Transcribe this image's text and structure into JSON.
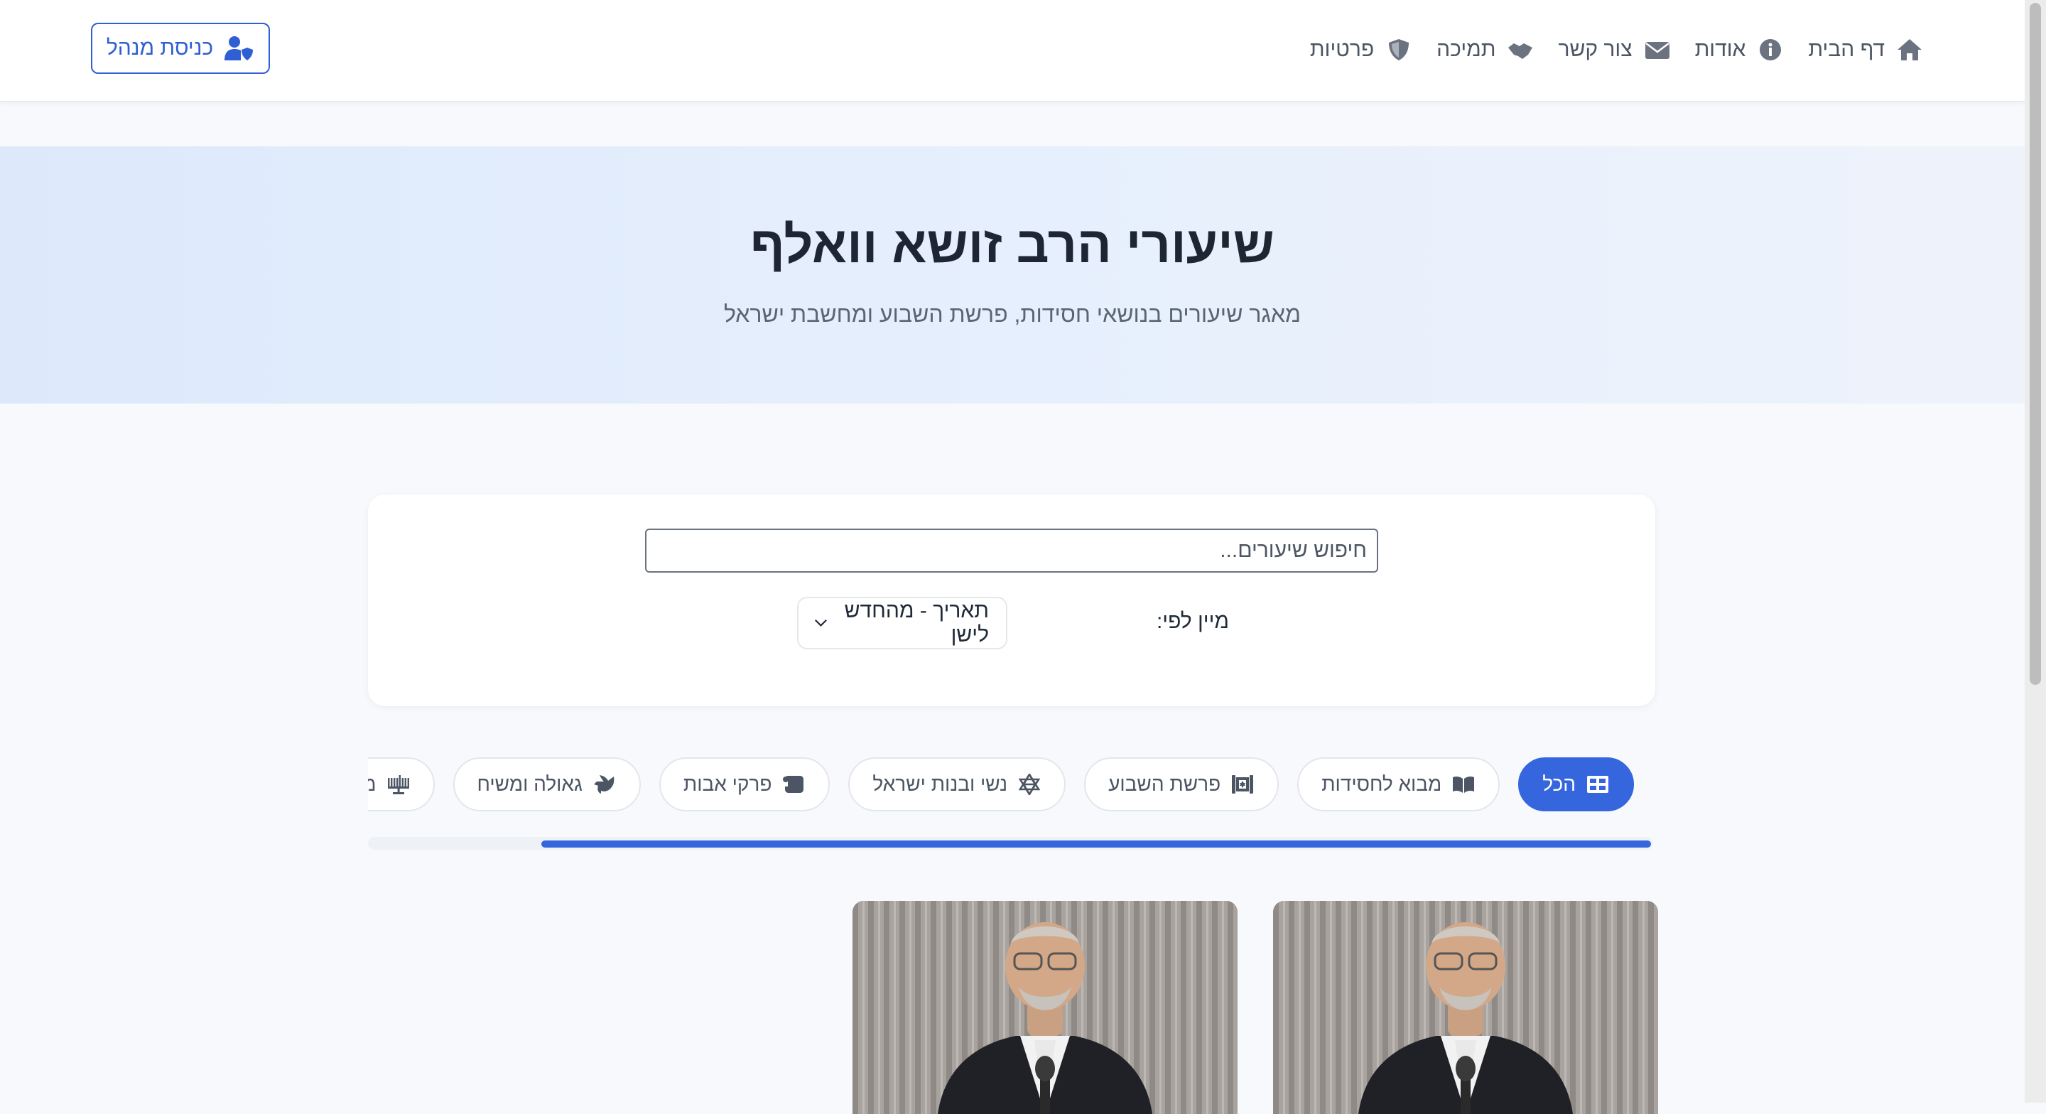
{
  "nav": {
    "links": [
      {
        "label": "דף הבית",
        "icon": "home-icon"
      },
      {
        "label": "אודות",
        "icon": "info-icon"
      },
      {
        "label": "צור קשר",
        "icon": "envelope-icon"
      },
      {
        "label": "תמיכה",
        "icon": "handshake-icon"
      },
      {
        "label": "פרטיות",
        "icon": "shield-icon"
      }
    ],
    "admin_button": "כניסת מנהל",
    "admin_icon": "user-shield-icon"
  },
  "hero": {
    "title": "שיעורי הרב זושא וואלף",
    "subtitle": "מאגר שיעורים בנושאי חסידות, פרשת השבוע ומחשבת ישראל"
  },
  "search": {
    "placeholder": "חיפוש שיעורים...",
    "value": "",
    "sort_label": "מיין לפי:",
    "sort_selected": "תאריך - מהחדש לישן"
  },
  "categories": [
    {
      "label": "הכל",
      "icon": "grid-icon",
      "active": true
    },
    {
      "label": "מבוא לחסידות",
      "icon": "book-open-icon",
      "active": false
    },
    {
      "label": "פרשת השבוע",
      "icon": "torah-icon",
      "active": false
    },
    {
      "label": "נשי ובנות ישראל",
      "icon": "star-of-david-icon",
      "active": false
    },
    {
      "label": "פרקי אבות",
      "icon": "scroll-icon",
      "active": false
    },
    {
      "label": "גאולה ומשיח",
      "icon": "dove-icon",
      "active": false
    },
    {
      "label": "מועדים",
      "icon": "menorah-icon",
      "active": false
    }
  ],
  "colors": {
    "accent": "#3566dd",
    "hero_bg": "#e3ecfb",
    "page_bg": "#f7f9fc"
  }
}
